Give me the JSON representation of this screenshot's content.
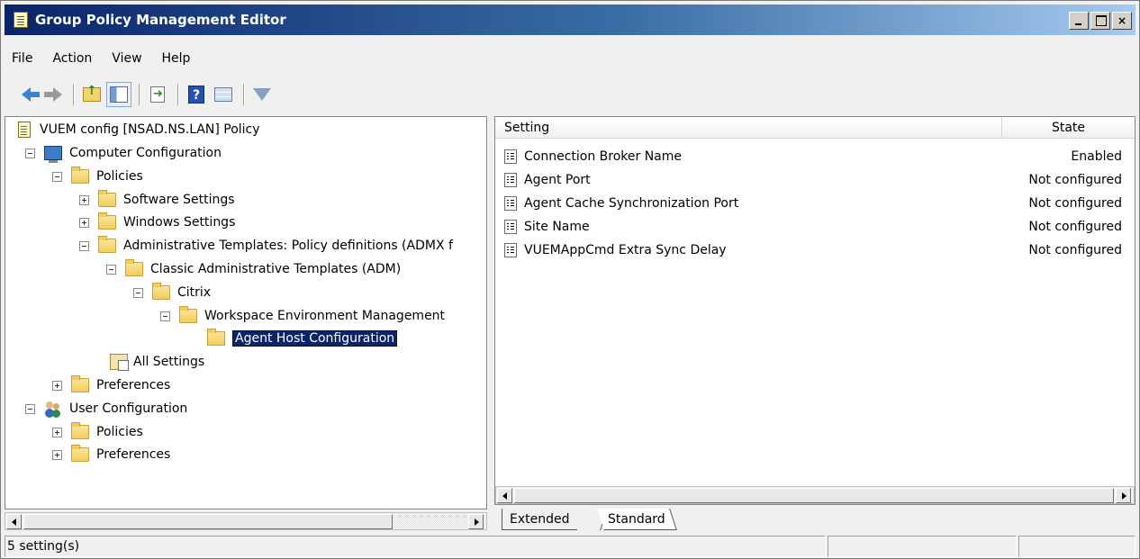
{
  "window": {
    "title": "Group Policy Management Editor",
    "controls": [
      "minimize",
      "maximize",
      "close"
    ],
    "close_glyph": "×"
  },
  "menu": [
    "File",
    "Action",
    "View",
    "Help"
  ],
  "toolbar": [
    "back-icon",
    "forward-icon",
    "up-folder-icon",
    "show-hide-tree-icon",
    "export-list-icon",
    "help-icon",
    "properties-icon",
    "filter-icon"
  ],
  "tree": {
    "items": [
      {
        "label": "VUEM config [NSAD.NS.LAN] Policy",
        "icon": "policy-doc-icon"
      },
      {
        "label": "Computer Configuration",
        "icon": "computer-icon",
        "expanded": true
      },
      {
        "label": "Policies",
        "icon": "folder-icon",
        "expanded": true
      },
      {
        "label": "Software Settings",
        "icon": "folder-icon",
        "expanded": false
      },
      {
        "label": "Windows Settings",
        "icon": "folder-icon",
        "expanded": false
      },
      {
        "label": "Administrative Templates: Policy definitions (ADMX f",
        "icon": "folder-icon",
        "expanded": true
      },
      {
        "label": "Classic Administrative Templates (ADM)",
        "icon": "folder-icon",
        "expanded": true
      },
      {
        "label": "Citrix",
        "icon": "folder-icon",
        "expanded": true
      },
      {
        "label": "Workspace Environment Management",
        "icon": "folder-icon",
        "expanded": true
      },
      {
        "label": "Agent Host Configuration",
        "icon": "folder-icon",
        "selected": true
      },
      {
        "label": "All Settings",
        "icon": "all-settings-icon"
      },
      {
        "label": "Preferences",
        "icon": "folder-icon",
        "expanded": false
      },
      {
        "label": "User Configuration",
        "icon": "users-icon",
        "expanded": true
      },
      {
        "label": "Policies",
        "icon": "folder-icon",
        "expanded": false
      },
      {
        "label": "Preferences",
        "icon": "folder-icon",
        "expanded": false
      }
    ]
  },
  "list": {
    "columns": {
      "setting": "Setting",
      "state": "State"
    },
    "rows": [
      {
        "setting": "Connection Broker Name",
        "state": "Enabled"
      },
      {
        "setting": "Agent Port",
        "state": "Not configured"
      },
      {
        "setting": "Agent Cache Synchronization Port",
        "state": "Not configured"
      },
      {
        "setting": "Site Name",
        "state": "Not configured"
      },
      {
        "setting": "VUEMAppCmd Extra Sync Delay",
        "state": "Not configured"
      }
    ]
  },
  "tabs": {
    "extended": "Extended",
    "standard": "Standard",
    "active": "Standard"
  },
  "status": {
    "text": "5 setting(s)"
  }
}
